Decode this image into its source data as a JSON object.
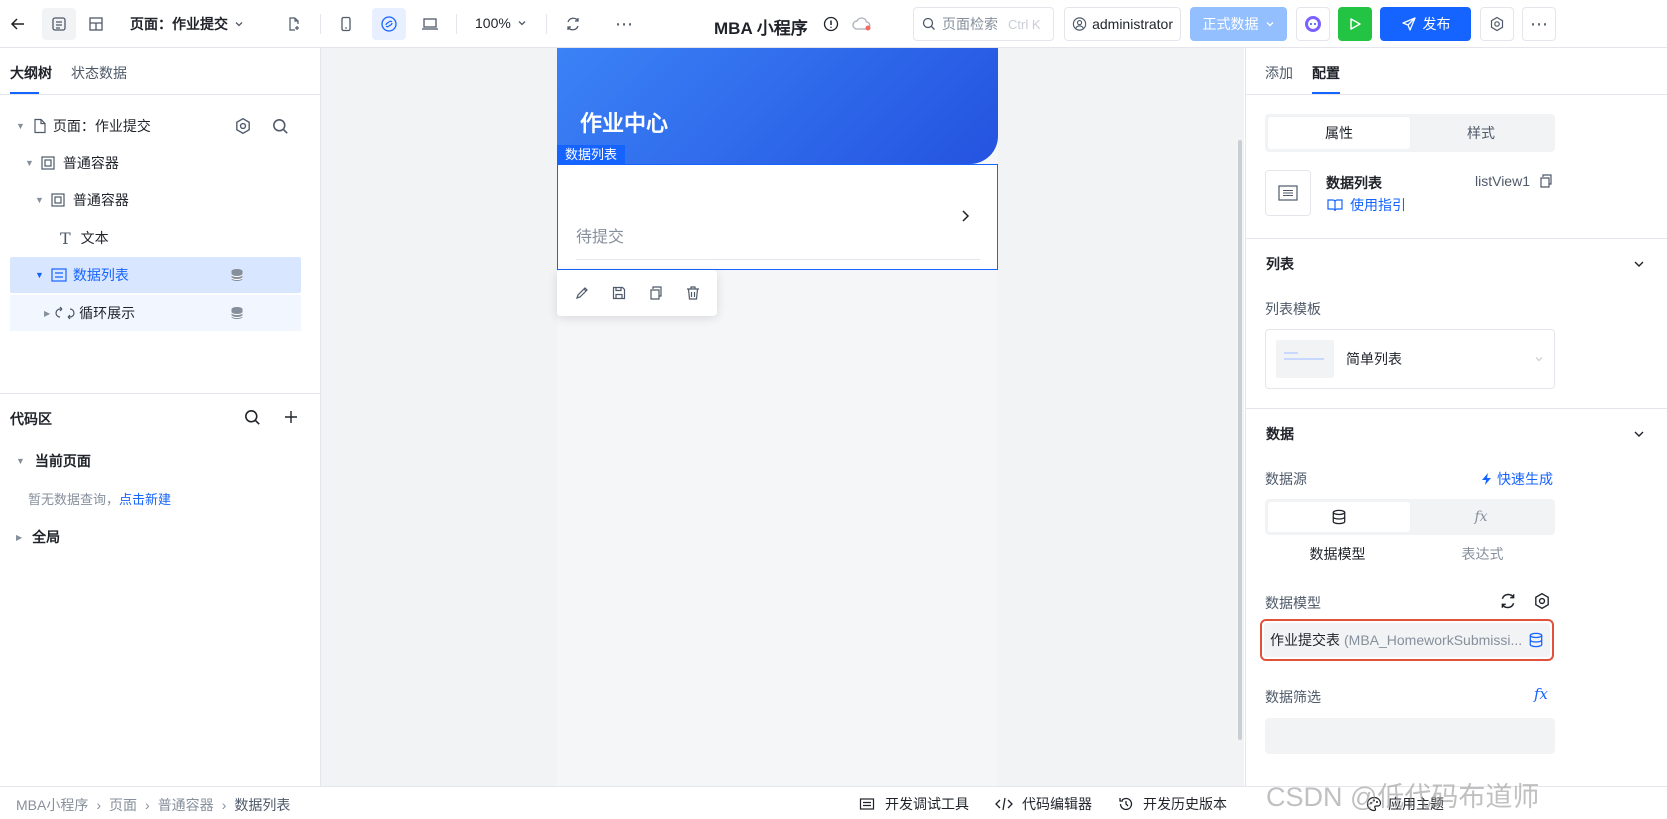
{
  "topbar": {
    "page_label": "页面：作业提交",
    "zoom": "100%",
    "app_title": "MBA 小程序",
    "search_placeholder": "页面检索",
    "search_shortcut": "Ctrl K",
    "user": "administrator",
    "env": "正式数据",
    "publish": "发布",
    "accent": "#1664ff"
  },
  "left": {
    "tabs": [
      "大纲树",
      "状态数据"
    ],
    "tree": [
      {
        "label": "页面：作业提交"
      },
      {
        "label": "普通容器"
      },
      {
        "label": "普通容器"
      },
      {
        "label": "文本"
      },
      {
        "label": "数据列表"
      },
      {
        "label": "循环展示"
      }
    ],
    "code_title": "代码区",
    "current_page": "当前页面",
    "no_query": "暂无数据查询，",
    "create_link": "点击新建",
    "global": "全局"
  },
  "canvas": {
    "header_title": "作业中心",
    "selection_label": "数据列表",
    "list_item_text": "待提交"
  },
  "right": {
    "tabs": [
      "添加",
      "配置"
    ],
    "seg": [
      "属性",
      "样式"
    ],
    "comp_name": "数据列表",
    "comp_id": "listView1",
    "guide": "使用指引",
    "list_section": "列表",
    "template_label": "列表模板",
    "template_value": "简单列表",
    "data_section": "数据",
    "source_label": "数据源",
    "quick_gen": "快速生成",
    "source_opts": [
      "数据模型",
      "表达式"
    ],
    "model_label": "数据模型",
    "model_value": "作业提交表",
    "model_sub": "(MBA_HomeworkSubmissi...",
    "filter_label": "数据筛选"
  },
  "bottom": {
    "breadcrumb": [
      "MBA小程序",
      "页面",
      "普通容器",
      "数据列表"
    ],
    "tools": [
      "开发调试工具",
      "代码编辑器",
      "开发历史版本",
      "应用主题"
    ],
    "watermark": "CSDN @低代码布道师"
  }
}
